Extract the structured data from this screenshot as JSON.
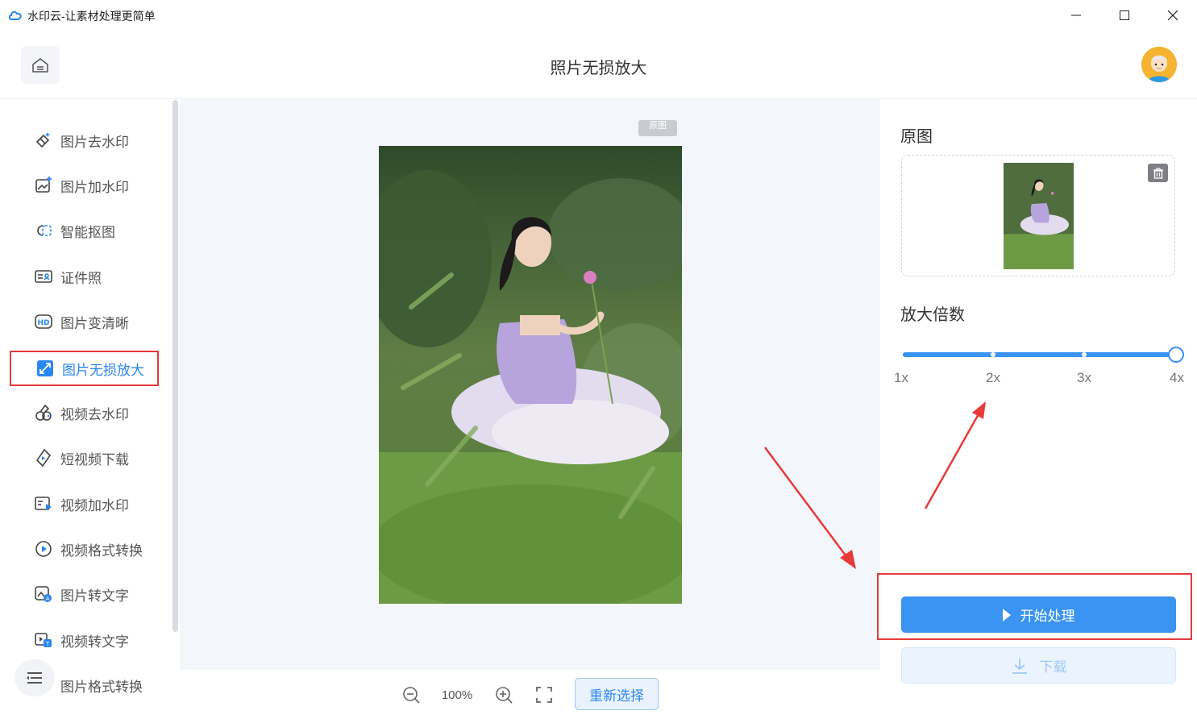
{
  "window": {
    "title": "水印云-让素材处理更简单"
  },
  "header": {
    "title": "照片无损放大"
  },
  "sidebar": {
    "items": [
      {
        "label": "图片去水印",
        "icon": "eraser-icon"
      },
      {
        "label": "图片加水印",
        "icon": "image-add-icon"
      },
      {
        "label": "智能抠图",
        "icon": "cutout-icon"
      },
      {
        "label": "证件照",
        "icon": "id-card-icon"
      },
      {
        "label": "图片变清晰",
        "icon": "hd-icon"
      },
      {
        "label": "图片无损放大",
        "icon": "enlarge-icon",
        "active": true
      },
      {
        "label": "视频去水印",
        "icon": "video-eraser-icon"
      },
      {
        "label": "短视频下载",
        "icon": "short-video-download-icon"
      },
      {
        "label": "视频加水印",
        "icon": "video-watermark-icon"
      },
      {
        "label": "视频格式转换",
        "icon": "video-convert-icon"
      },
      {
        "label": "图片转文字",
        "icon": "image-ocr-icon"
      },
      {
        "label": "视频转文字",
        "icon": "video-text-icon"
      },
      {
        "label": "图片格式转换",
        "icon": "image-format-icon"
      }
    ]
  },
  "canvas": {
    "original_tag": "原图"
  },
  "toolbar": {
    "zoom": "100%",
    "reselect_label": "重新选择"
  },
  "panel": {
    "original_label": "原图",
    "scale_label": "放大倍数",
    "scale_options": [
      "1x",
      "2x",
      "3x",
      "4x"
    ],
    "selected_scale": "4x",
    "start_label": "开始处理",
    "download_label": "下载"
  },
  "colors": {
    "accent": "#3b93f2",
    "highlight": "#e8393b"
  }
}
